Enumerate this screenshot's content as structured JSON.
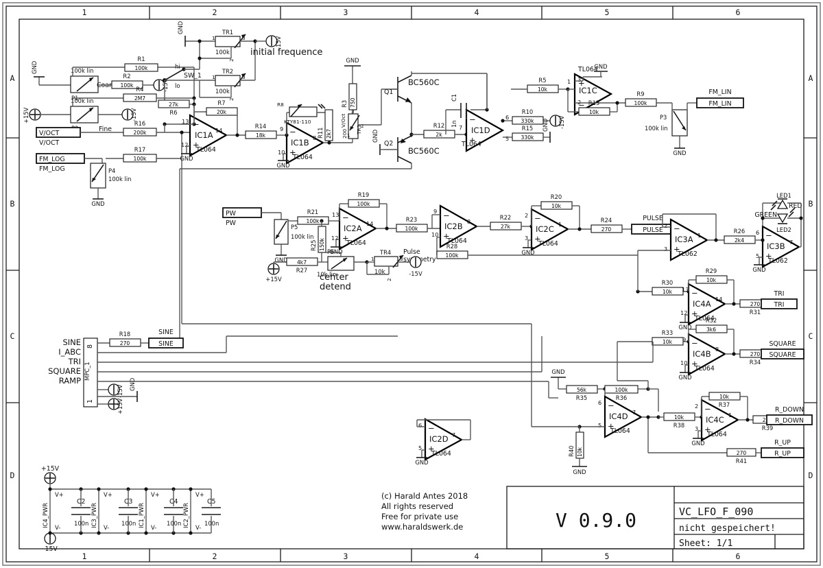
{
  "sheet": {
    "columns": [
      "1",
      "2",
      "3",
      "4",
      "5",
      "6"
    ],
    "rows": [
      "A",
      "B",
      "C",
      "D"
    ]
  },
  "title_block": {
    "copyright_lines": [
      "(c) Harald Antes 2018",
      "All rights reserved",
      "Free for private use",
      "www.haraldswerk.de"
    ],
    "version": "V 0.9.0",
    "project": "VC_LFO_F_090",
    "status": "nicht gespeichert!",
    "sheet_label": "Sheet: 1/1"
  },
  "annotations": {
    "initial_frequence": "initial frequence",
    "center_detend": "center\ndetend",
    "center_line1": "center",
    "center_line2": "detend",
    "pulse_symmetry_1": "Pulse",
    "pulse_symmetry_2": "symmetry",
    "coarse": "Coarse",
    "fine": "Fine",
    "sw_hi": "hi",
    "sw_lo": "lo",
    "sw_name": "SW_1"
  },
  "ports": [
    {
      "name": "V/OCT",
      "label": "V/OCT"
    },
    {
      "name": "FM_LOG",
      "label": "FM_LOG"
    },
    {
      "name": "FM_LIN",
      "label": "FM_LIN"
    },
    {
      "name": "PW",
      "label": "PW"
    },
    {
      "name": "PULSE",
      "label": "PULSE"
    },
    {
      "name": "TRI",
      "label": "TRI"
    },
    {
      "name": "SQUARE",
      "label": "SQUARE"
    },
    {
      "name": "SINE",
      "label": "SINE"
    },
    {
      "name": "R_DOWN",
      "label": "R_DOWN"
    },
    {
      "name": "R_UP",
      "label": "R_UP"
    }
  ],
  "connector": {
    "name": "MPC_1",
    "pins": [
      "SINE",
      "I_ABC",
      "TRI",
      "SQUARE",
      "RAMP"
    ],
    "pin_top": "8",
    "pin_bottom": "1",
    "rails": [
      "-15V",
      "GND",
      "+15V"
    ]
  },
  "opamps": [
    {
      "ref": "IC1A",
      "type": "TL064",
      "pins": {
        "in_neg": "13",
        "in_pos": "12",
        "out": "14"
      }
    },
    {
      "ref": "IC1B",
      "type": "TL064",
      "pins": {
        "in_neg": "9",
        "in_pos": "10",
        "out": "8"
      }
    },
    {
      "ref": "IC1C",
      "type": "TL064",
      "pins": {
        "in_neg": "2",
        "in_pos": "3",
        "out": "1"
      }
    },
    {
      "ref": "IC1D",
      "type": "TL064",
      "pins": {
        "in_neg": "6",
        "in_pos": "5",
        "out": "7"
      }
    },
    {
      "ref": "IC2A",
      "type": "TL064",
      "pins": {
        "in_neg": "13",
        "in_pos": "12",
        "out": "14"
      }
    },
    {
      "ref": "IC2B",
      "type": "TL064",
      "pins": {
        "in_neg": "9",
        "in_pos": "10",
        "out": "8"
      }
    },
    {
      "ref": "IC2C",
      "type": "TL064",
      "pins": {
        "in_neg": "2",
        "in_pos": "3",
        "out": "1"
      }
    },
    {
      "ref": "IC2D",
      "type": "TL064",
      "pins": {
        "in_neg": "6",
        "in_pos": "5",
        "out": "7"
      }
    },
    {
      "ref": "IC3A",
      "type": "TL062",
      "pins": {
        "in_neg": "2",
        "in_pos": "3",
        "out": "1"
      }
    },
    {
      "ref": "IC3B",
      "type": "TL062",
      "pins": {
        "in_neg": "6",
        "in_pos": "5",
        "out": "7"
      }
    },
    {
      "ref": "IC4A",
      "type": "TL064",
      "pins": {
        "in_neg": "13",
        "in_pos": "12",
        "out": "14"
      }
    },
    {
      "ref": "IC4B",
      "type": "TL064",
      "pins": {
        "in_neg": "9",
        "in_pos": "10",
        "out": "8"
      }
    },
    {
      "ref": "IC4C",
      "type": "TL064",
      "pins": {
        "in_neg": "2",
        "in_pos": "3",
        "out": "1"
      }
    },
    {
      "ref": "IC4D",
      "type": "TL064",
      "pins": {
        "in_neg": "6",
        "in_pos": "5",
        "out": "7"
      }
    }
  ],
  "resistors": [
    {
      "ref": "R1",
      "value": "100k"
    },
    {
      "ref": "R2",
      "value": "100k"
    },
    {
      "ref": "R3",
      "value": "750"
    },
    {
      "ref": "R4",
      "value": "2M7"
    },
    {
      "ref": "R5",
      "value": "10k"
    },
    {
      "ref": "R6",
      "value": "27k"
    },
    {
      "ref": "R7",
      "value": "20k"
    },
    {
      "ref": "R8",
      "value": "KTY81-110"
    },
    {
      "ref": "R9",
      "value": "100k"
    },
    {
      "ref": "R10",
      "value": "330k"
    },
    {
      "ref": "R11",
      "value": "2k7"
    },
    {
      "ref": "R12",
      "value": "2k"
    },
    {
      "ref": "R13",
      "value": "10k"
    },
    {
      "ref": "R14",
      "value": "18k"
    },
    {
      "ref": "R15",
      "value": "330k"
    },
    {
      "ref": "R16",
      "value": "200k"
    },
    {
      "ref": "R17",
      "value": "100k"
    },
    {
      "ref": "R18",
      "value": "270"
    },
    {
      "ref": "R19",
      "value": "100k"
    },
    {
      "ref": "R20",
      "value": "10k"
    },
    {
      "ref": "R21",
      "value": "100k"
    },
    {
      "ref": "R22",
      "value": "27k"
    },
    {
      "ref": "R23",
      "value": "100k"
    },
    {
      "ref": "R24",
      "value": "270"
    },
    {
      "ref": "R25",
      "value": "150k"
    },
    {
      "ref": "R26",
      "value": "2k4"
    },
    {
      "ref": "R27",
      "value": "4k7"
    },
    {
      "ref": "R28",
      "value": "100k"
    },
    {
      "ref": "R29",
      "value": "10k"
    },
    {
      "ref": "R30",
      "value": "10k"
    },
    {
      "ref": "R31",
      "value": "270"
    },
    {
      "ref": "R32",
      "value": "3k6"
    },
    {
      "ref": "R33",
      "value": "10k"
    },
    {
      "ref": "R34",
      "value": "270"
    },
    {
      "ref": "R35",
      "value": "56k"
    },
    {
      "ref": "R36",
      "value": "100k"
    },
    {
      "ref": "R37",
      "value": "10k"
    },
    {
      "ref": "R38",
      "value": "10k"
    },
    {
      "ref": "R39",
      "value": "270"
    },
    {
      "ref": "R40",
      "value": "10k"
    },
    {
      "ref": "R41",
      "value": "270"
    }
  ],
  "potentiometers": [
    {
      "ref": "P1",
      "value": "100k lin",
      "label": "Coarse"
    },
    {
      "ref": "P2",
      "value": "100k lin",
      "label": "Fine"
    },
    {
      "ref": "P3",
      "value": "100k lin",
      "label": ""
    },
    {
      "ref": "P4",
      "value": "100k lin",
      "label": ""
    },
    {
      "ref": "P5",
      "value": "100k lin",
      "label": ""
    },
    {
      "ref": "P6",
      "value": "10k lin",
      "label": "center detend"
    }
  ],
  "trimmers": [
    {
      "ref": "TR1",
      "value": "100k",
      "pins": [
        "1",
        "3",
        "2"
      ]
    },
    {
      "ref": "TR2",
      "value": "100k",
      "pins": [
        "1",
        "3",
        "2"
      ]
    },
    {
      "ref": "TR3",
      "value": "200",
      "pins": [
        "3",
        "2",
        "1"
      ],
      "label": "V/Oct"
    },
    {
      "ref": "TR4",
      "value": "10k",
      "pins": [
        "1",
        "3",
        "2"
      ],
      "label": "Pulse symmetry"
    }
  ],
  "transistors": [
    {
      "ref": "Q1",
      "type": "BC560C"
    },
    {
      "ref": "Q2",
      "type": "BC560C"
    }
  ],
  "capacitors": [
    {
      "ref": "C1",
      "value": "1n"
    },
    {
      "ref": "C2",
      "value": "100n"
    },
    {
      "ref": "C3",
      "value": "100n"
    },
    {
      "ref": "C4",
      "value": "100n"
    },
    {
      "ref": "C5",
      "value": "100n"
    }
  ],
  "leds": [
    {
      "ref": "LED1",
      "color": "RED"
    },
    {
      "ref": "LED2",
      "color": "GREEN"
    }
  ],
  "power_blocks": [
    {
      "ref": "IC4_PWR",
      "cap": "C2",
      "cap_value": "100n"
    },
    {
      "ref": "IC3_PWR",
      "cap": "C3",
      "cap_value": "100n"
    },
    {
      "ref": "IC1_PWR",
      "cap": "C4",
      "cap_value": "100n"
    },
    {
      "ref": "IC2_PWR",
      "cap": "C5",
      "cap_value": "100n"
    }
  ],
  "rails": {
    "pos": "+15V",
    "neg": "-15V",
    "gnd": "GND",
    "vplus": "V+",
    "vminus": "V-"
  }
}
